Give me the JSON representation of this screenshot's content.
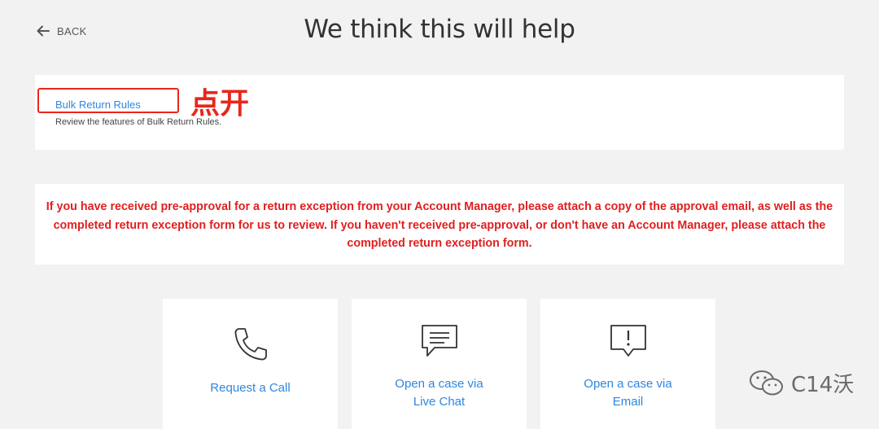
{
  "header": {
    "back_label": "BACK",
    "title": "We think this will help"
  },
  "help": {
    "link_text": "Bulk Return Rules",
    "description": "Review the features of Bulk Return Rules.",
    "annotation": "点开"
  },
  "notice": {
    "text": "If you have received pre-approval for a return exception from your Account Manager, please attach a copy of the approval email, as well as the completed return exception form for us to review. If you haven't received pre-approval, or don't have an Account Manager, please attach the completed return exception form."
  },
  "contact_options": [
    {
      "label_line1": "Request a Call",
      "label_line2": "",
      "icon": "phone-icon"
    },
    {
      "label_line1": "Open a case via",
      "label_line2": "Live Chat",
      "icon": "chat-icon"
    },
    {
      "label_line1": "Open a case via",
      "label_line2": "Email",
      "icon": "email-alert-icon"
    }
  ],
  "watermark": {
    "text": "C14沃",
    "icon": "wechat-icon"
  },
  "colors": {
    "link": "#2e86de",
    "alert_red": "#e02020",
    "annotation_red": "#e8271b",
    "background": "#f2f2f2"
  }
}
